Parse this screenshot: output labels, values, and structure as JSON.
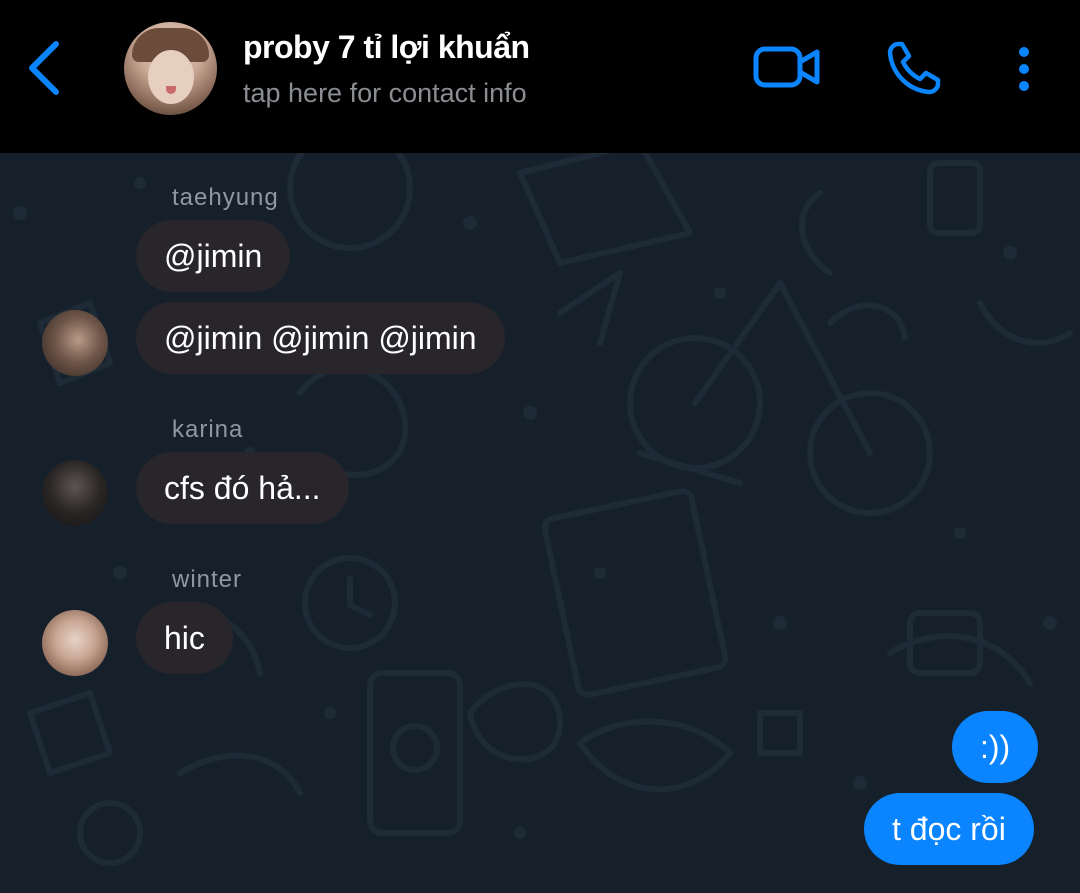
{
  "header": {
    "title": "proby 7 tỉ lợi khuẩn",
    "subtitle": "tap here for contact info",
    "accent_color": "#0a84ff",
    "icons": [
      "back-chevron-icon",
      "video-call-icon",
      "phone-icon",
      "more-vertical-icon"
    ]
  },
  "messages": [
    {
      "sender": "taehyung",
      "text": "@jimin",
      "direction": "incoming"
    },
    {
      "sender": "taehyung",
      "text": "@jimin @jimin @jimin",
      "direction": "incoming"
    },
    {
      "sender": "karina",
      "text": "cfs đó hả...",
      "direction": "incoming"
    },
    {
      "sender": "winter",
      "text": "hic",
      "direction": "incoming"
    },
    {
      "sender": "",
      "text": ":))",
      "direction": "outgoing"
    },
    {
      "sender": "",
      "text": "t đọc rồi",
      "direction": "outgoing"
    }
  ],
  "colors": {
    "header_bg": "#000000",
    "chat_bg": "#15202b",
    "incoming_bubble": "#28252b",
    "outgoing_bubble": "#0a84ff"
  }
}
